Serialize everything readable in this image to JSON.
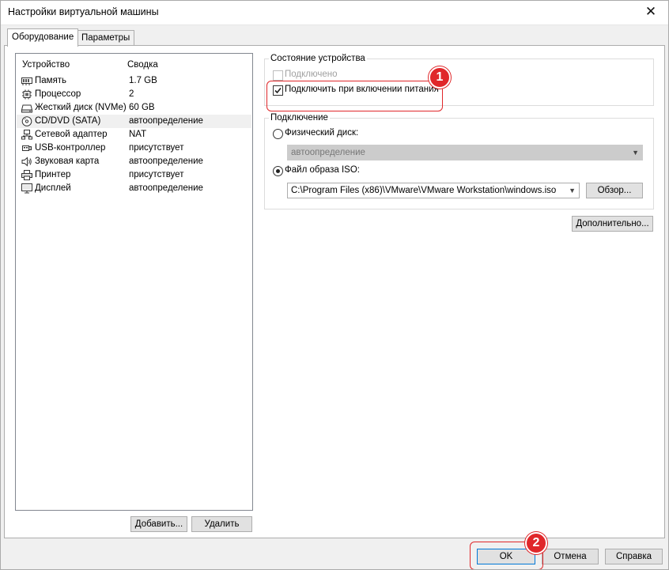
{
  "window": {
    "title": "Настройки виртуальной машины",
    "close_glyph": "✕"
  },
  "tabs": [
    {
      "label": "Оборудование",
      "active": true
    },
    {
      "label": "Параметры",
      "active": false
    }
  ],
  "device_list": {
    "headers": {
      "device": "Устройство",
      "summary": "Сводка"
    },
    "rows": [
      {
        "icon": "memory-icon",
        "name": "Память",
        "summary": "1.7 GB"
      },
      {
        "icon": "processor-icon",
        "name": "Процессор",
        "summary": "2"
      },
      {
        "icon": "hard-disk-icon",
        "name": "Жесткий диск (NVMe)",
        "summary": "60 GB"
      },
      {
        "icon": "cd-dvd-icon",
        "name": "CD/DVD (SATA)",
        "summary": "автоопределение",
        "selected": true
      },
      {
        "icon": "network-adapter-icon",
        "name": "Сетевой адаптер",
        "summary": "NAT"
      },
      {
        "icon": "usb-icon",
        "name": "USB-контроллер",
        "summary": "присутствует"
      },
      {
        "icon": "sound-card-icon",
        "name": "Звуковая карта",
        "summary": "автоопределение"
      },
      {
        "icon": "printer-icon",
        "name": "Принтер",
        "summary": "присутствует"
      },
      {
        "icon": "display-icon",
        "name": "Дисплей",
        "summary": "автоопределение"
      }
    ],
    "add_button": "Добавить...",
    "remove_button": "Удалить"
  },
  "device_status": {
    "group_label": "Состояние устройства",
    "connected_label": "Подключено",
    "connected_checked": false,
    "connect_at_power_on_label": "Подключить при включении питания",
    "connect_at_power_on_checked": true
  },
  "connection": {
    "group_label": "Подключение",
    "physical_label": "Физический диск:",
    "physical_value": "автоопределение",
    "iso_label": "Файл образа ISO:",
    "iso_path": "C:\\Program Files (x86)\\VMware\\VMware Workstation\\windows.iso",
    "browse_button": "Обзор...",
    "selected": "iso"
  },
  "advanced_button": "Дополнительно...",
  "footer": {
    "ok": "OK",
    "cancel": "Отмена",
    "help": "Справка"
  },
  "annotations": [
    {
      "number": "1"
    },
    {
      "number": "2"
    }
  ],
  "colors": {
    "annotation": "#e0272a",
    "focus": "#0078d7"
  }
}
